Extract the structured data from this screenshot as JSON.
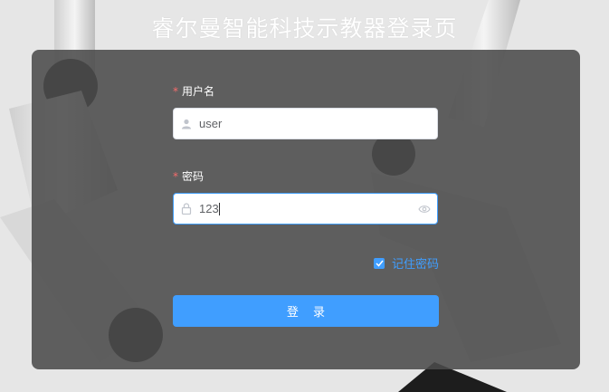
{
  "page": {
    "title": "睿尔曼智能科技示教器登录页"
  },
  "form": {
    "username": {
      "label": "用户名",
      "required_mark": "*",
      "value": "user",
      "icon": "user-icon"
    },
    "password": {
      "label": "密码",
      "required_mark": "*",
      "value": "123",
      "icon": "lock-icon",
      "toggle_icon": "eye-icon"
    },
    "remember": {
      "label": "记住密码",
      "checked": true
    },
    "submit_label": "登 录"
  },
  "colors": {
    "accent": "#409eff",
    "required": "#f56c6c",
    "panel": "#4b4b4b"
  }
}
